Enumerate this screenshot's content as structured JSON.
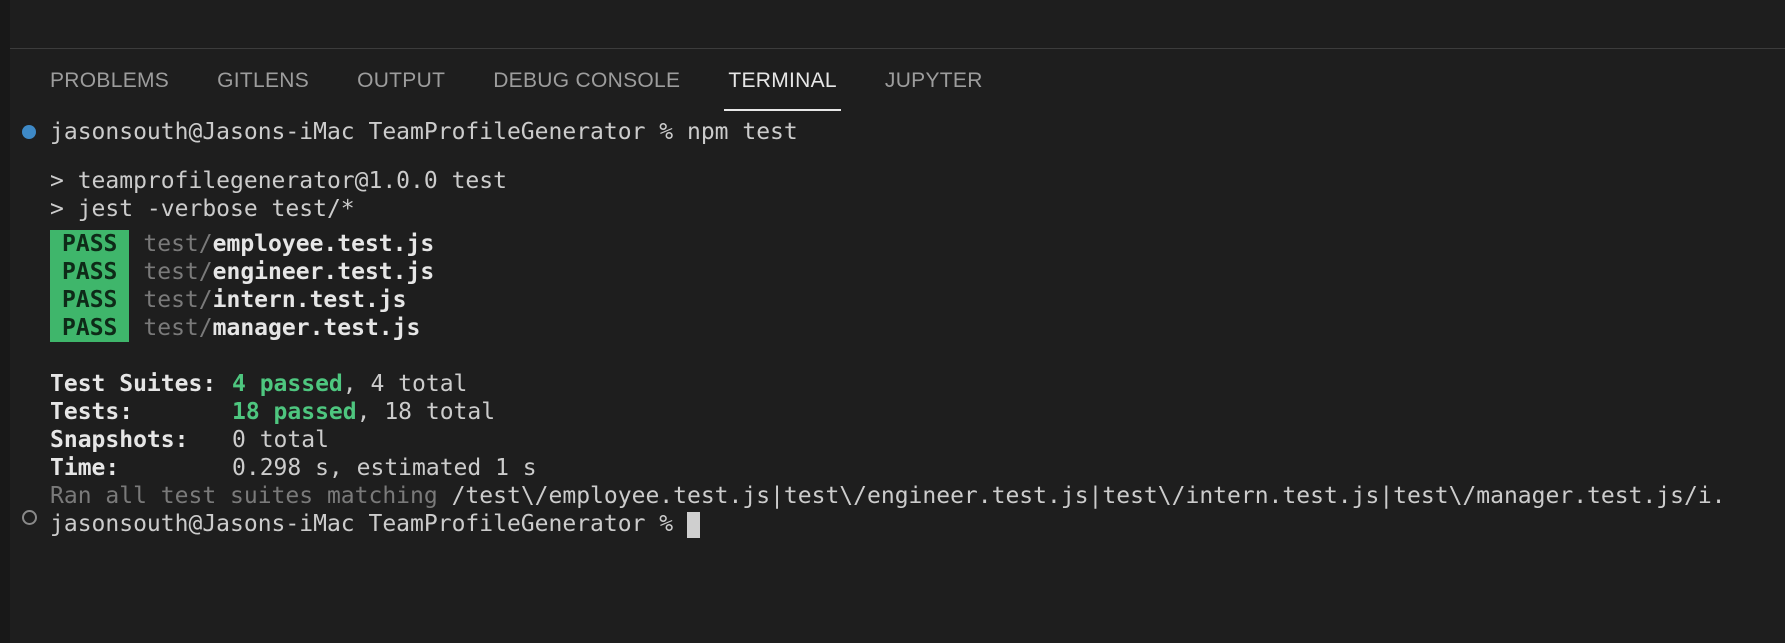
{
  "tabs": [
    {
      "label": "PROBLEMS",
      "active": false
    },
    {
      "label": "GITLENS",
      "active": false
    },
    {
      "label": "OUTPUT",
      "active": false
    },
    {
      "label": "DEBUG CONSOLE",
      "active": false
    },
    {
      "label": "TERMINAL",
      "active": true
    },
    {
      "label": "JUPYTER",
      "active": false
    }
  ],
  "terminal": {
    "prompt1": "jasonsouth@Jasons-iMac TeamProfileGenerator % npm test",
    "script_line1": "> teamprofilegenerator@1.0.0 test",
    "script_line2": "> jest -verbose test/*",
    "pass_label": "PASS",
    "test_prefix": "test/",
    "tests": [
      "employee.test.js",
      "engineer.test.js",
      "intern.test.js",
      "manager.test.js"
    ],
    "summary": {
      "suites_label": "Test Suites:",
      "suites_passed": "4 passed",
      "suites_total": ", 4 total",
      "tests_label": "Tests:",
      "tests_passed": "18 passed",
      "tests_total": ", 18 total",
      "snapshots_label": "Snapshots:",
      "snapshots_value": "0 total",
      "time_label": "Time:",
      "time_value": "0.298 s, estimated 1 s"
    },
    "ran_prefix": "Ran all test suites matching ",
    "ran_pattern": "/test\\/employee.test.js|test\\/engineer.test.js|test\\/intern.test.js|test\\/manager.test.js/i.",
    "prompt2": "jasonsouth@Jasons-iMac TeamProfileGenerator % "
  },
  "colors": {
    "background": "#1e1e1e",
    "pass_badge": "#3fb66b",
    "passed_text": "#4ec67f",
    "prompt_dot_active": "#3e89c6"
  }
}
